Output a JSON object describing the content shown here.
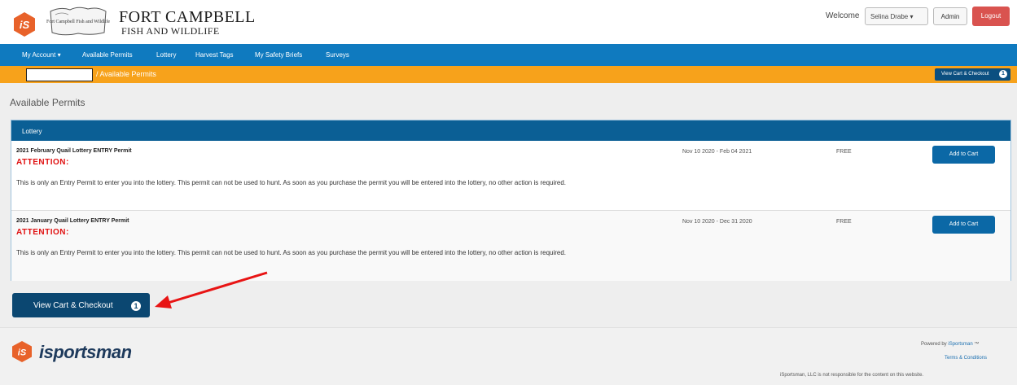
{
  "header": {
    "title": "FORT CAMPBELL",
    "subtitle": "FISH AND WILDLIFE",
    "badge_text": "Fort Campbell Fish and Wildlife",
    "welcome": "Welcome",
    "user_menu": "Selina Drabe ▾",
    "admin_label": "Admin",
    "logout_label": "Logout"
  },
  "nav": {
    "items": [
      "My Account ▾",
      "Available Permits",
      "Lottery",
      "Harvest Tags",
      "My Safety Briefs",
      "Surveys"
    ]
  },
  "breadcrumb": {
    "separator": "/",
    "current": "Available Permits",
    "cart_button": "View Cart & Checkout",
    "cart_count": "1"
  },
  "page": {
    "title": "Available Permits"
  },
  "panel": {
    "title": "Lottery",
    "permits": [
      {
        "name": "2021 February Quail Lottery ENTRY Permit",
        "attention": "ATTENTION:",
        "description": "This is only an Entry Permit to enter you into the lottery.  This permit can not be used to hunt.  As soon as you purchase the permit you will be entered into the lottery, no other action is required.",
        "dates": "Nov 10 2020 - Feb 04 2021",
        "price": "FREE",
        "button": "Add to Cart"
      },
      {
        "name": "2021 January Quail Lottery ENTRY Permit",
        "attention": "ATTENTION:",
        "description": "This is only an Entry Permit to enter you into the lottery.  This permit can not be used to hunt.  As soon as you purchase the permit you will be entered into the lottery, no other action is required.",
        "dates": "Nov 10 2020 - Dec 31 2020",
        "price": "FREE",
        "button": "Add to Cart"
      }
    ]
  },
  "checkout": {
    "label": "View Cart & Checkout",
    "count": "1"
  },
  "footer": {
    "brand": "isportsman",
    "powered_prefix": "Powered by",
    "powered_link": "iSportsman",
    "tm": "™",
    "terms": "Terms & Conditions",
    "disclaimer": "iSportsman, LLC is not responsible for the content on this website."
  },
  "colors": {
    "nav_blue": "#0f7abf",
    "breadcrumb_orange": "#f7a21b",
    "panel_head": "#0b5f95",
    "attention_red": "#e01010",
    "logout_red": "#d9534f",
    "annotation_arrow": "#e81414"
  }
}
